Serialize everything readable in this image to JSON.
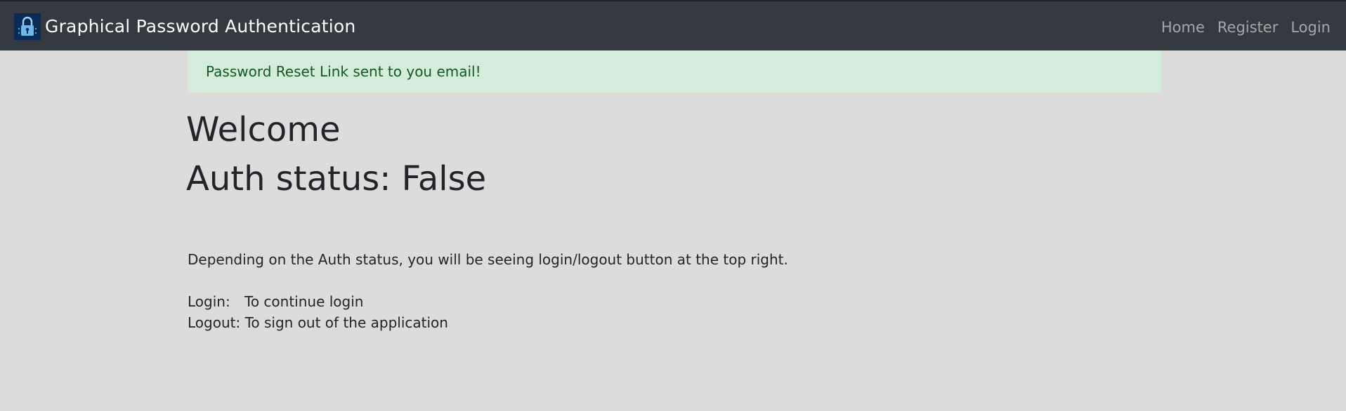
{
  "navbar": {
    "brand_title": "Graphical Password Authentication",
    "logo_icon": "padlock-logo-icon",
    "links": [
      {
        "label": "Home"
      },
      {
        "label": "Register"
      },
      {
        "label": "Login"
      }
    ]
  },
  "alert": {
    "message": "Password Reset Link sent to you email!"
  },
  "main": {
    "welcome": "Welcome",
    "auth_status": "Auth status: False",
    "description": "Depending on the Auth status, you will be seeing login/logout button at the top right.",
    "login_label": "Login:",
    "login_text": "To continue login",
    "logout_label": "Logout:",
    "logout_text": "To sign out of the application"
  },
  "colors": {
    "navbar_bg": "#343a40",
    "page_bg": "#dcdcdc",
    "alert_bg": "#d4edda",
    "alert_text": "#155724"
  }
}
